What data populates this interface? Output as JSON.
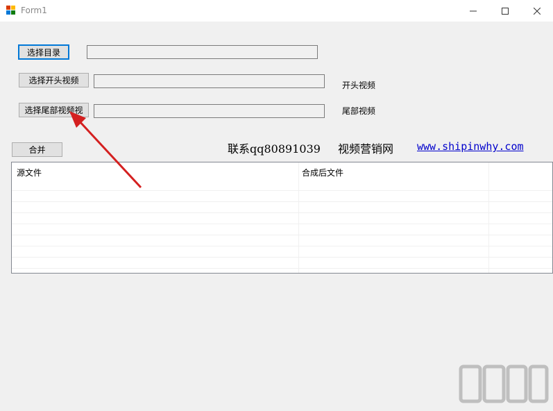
{
  "window": {
    "title": "Form1",
    "controls": {
      "minimize": "—",
      "maximize": "☐",
      "close": "✕"
    }
  },
  "form": {
    "select_dir_button": "选择目录",
    "select_dir_value": "",
    "select_head_button": "选择开头视频",
    "select_head_value": "",
    "head_label": "开头视频",
    "select_tail_button": "选择尾部视频视",
    "select_tail_value": "",
    "tail_label": "尾部视频",
    "merge_button": "合并",
    "contact_text": "联系qq80891039",
    "site_name": "视频营销网",
    "site_link": "www.shipinwhy.com"
  },
  "grid": {
    "columns": [
      "源文件",
      "合成后文件"
    ],
    "rows": []
  },
  "colors": {
    "annotation_arrow": "#d42020",
    "link": "#0000cc"
  }
}
